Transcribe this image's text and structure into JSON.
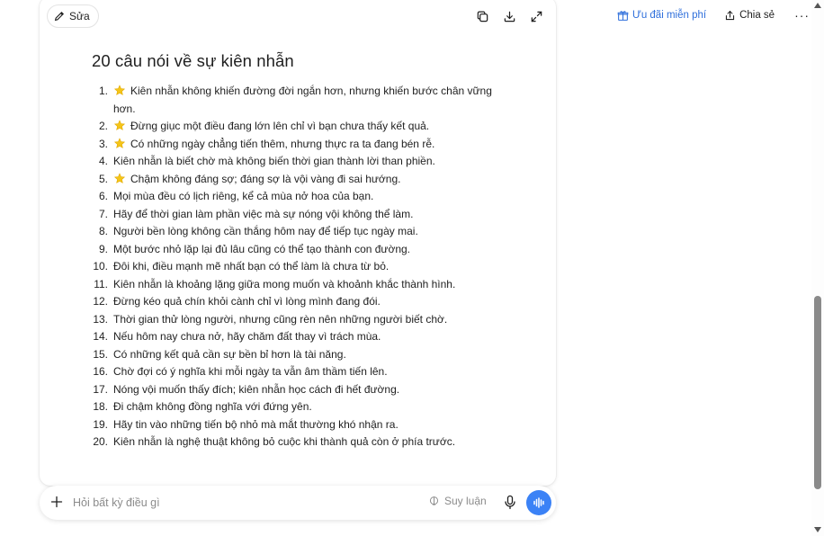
{
  "toolbar": {
    "edit_label": "Sửa",
    "copy_icon": "copy-icon",
    "download_icon": "download-icon",
    "expand_icon": "expand-icon"
  },
  "header": {
    "promo_label": "Ưu đãi miễn phí",
    "share_label": "Chia sẻ",
    "more_label": "···",
    "accent_color": "#2f6fdb"
  },
  "document": {
    "title": "20 câu nói về sự kiên nhẫn",
    "items": [
      {
        "num": "1.",
        "star": true,
        "text": "Kiên nhẫn không khiến đường đời ngắn hơn, nhưng khiến bước chân vững hơn."
      },
      {
        "num": "2.",
        "star": true,
        "text": "Đừng giục một điều đang lớn lên chỉ vì bạn chưa thấy kết quả."
      },
      {
        "num": "3.",
        "star": true,
        "text": "Có những ngày chẳng tiến thêm, nhưng thực ra ta đang bén rễ."
      },
      {
        "num": "4.",
        "star": false,
        "text": "Kiên nhẫn là biết chờ mà không biến thời gian thành lời than phiền."
      },
      {
        "num": "5.",
        "star": true,
        "text": "Chậm không đáng sợ; đáng sợ là vội vàng đi sai hướng."
      },
      {
        "num": "6.",
        "star": false,
        "text": "Mọi mùa đều có lịch riêng, kể cả mùa nở hoa của bạn."
      },
      {
        "num": "7.",
        "star": false,
        "text": "Hãy để thời gian làm phần việc mà sự nóng vội không thể làm."
      },
      {
        "num": "8.",
        "star": false,
        "text": "Người bền lòng không cần thắng hôm nay để tiếp tục ngày mai."
      },
      {
        "num": "9.",
        "star": false,
        "text": "Một bước nhỏ lặp lại đủ lâu cũng có thể tạo thành con đường."
      },
      {
        "num": "10.",
        "star": false,
        "text": "Đôi khi, điều mạnh mẽ nhất bạn có thể làm là chưa từ bỏ."
      },
      {
        "num": "11.",
        "star": false,
        "text": "Kiên nhẫn là khoảng lặng giữa mong muốn và khoảnh khắc thành hình."
      },
      {
        "num": "12.",
        "star": false,
        "text": "Đừng kéo quả chín khỏi cành chỉ vì lòng mình đang đói."
      },
      {
        "num": "13.",
        "star": false,
        "text": "Thời gian thử lòng người, nhưng cũng rèn nên những người biết chờ."
      },
      {
        "num": "14.",
        "star": false,
        "text": "Nếu hôm nay chưa nở, hãy chăm đất thay vì trách mùa."
      },
      {
        "num": "15.",
        "star": false,
        "text": "Có những kết quả cần sự bền bỉ hơn là tài năng."
      },
      {
        "num": "16.",
        "star": false,
        "text": "Chờ đợi có ý nghĩa khi mỗi ngày ta vẫn âm thầm tiến lên."
      },
      {
        "num": "17.",
        "star": false,
        "text": "Nóng vội muốn thấy đích; kiên nhẫn học cách đi hết đường."
      },
      {
        "num": "18.",
        "star": false,
        "text": "Đi chậm không đồng nghĩa với đứng yên."
      },
      {
        "num": "19.",
        "star": false,
        "text": "Hãy tin vào những tiến bộ nhỏ mà mắt thường khó nhận ra."
      },
      {
        "num": "20.",
        "star": false,
        "text": "Kiên nhẫn là nghệ thuật không bỏ cuộc khi thành quả còn ở phía trước."
      }
    ]
  },
  "composer": {
    "placeholder": "Hỏi bất kỳ điều gì",
    "value": "",
    "reason_label": "Suy luận",
    "voice_color": "#3b82f6"
  },
  "scroll": {
    "position_fraction": 0.56
  }
}
